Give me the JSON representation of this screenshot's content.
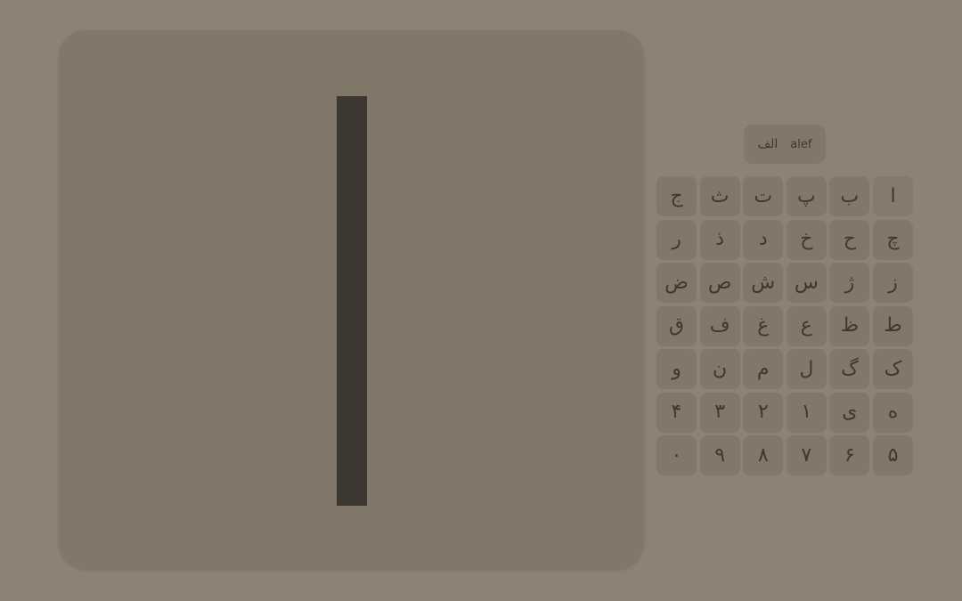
{
  "current_letter": {
    "persian": "الف",
    "latin": "alef"
  },
  "keys": [
    "ا",
    "ب",
    "پ",
    "ت",
    "ث",
    "ج",
    "چ",
    "ح",
    "خ",
    "د",
    "ذ",
    "ر",
    "ز",
    "ژ",
    "س",
    "ش",
    "ص",
    "ض",
    "ط",
    "ظ",
    "ع",
    "غ",
    "ف",
    "ق",
    "ک",
    "گ",
    "ل",
    "م",
    "ن",
    "و",
    "ه",
    "ی",
    "۱",
    "۲",
    "۳",
    "۴",
    "۵",
    "۶",
    "۷",
    "۸",
    "۹",
    "۰"
  ],
  "colors": {
    "background": "#8d8374",
    "panel": "#827869",
    "ink": "#3e3832"
  }
}
